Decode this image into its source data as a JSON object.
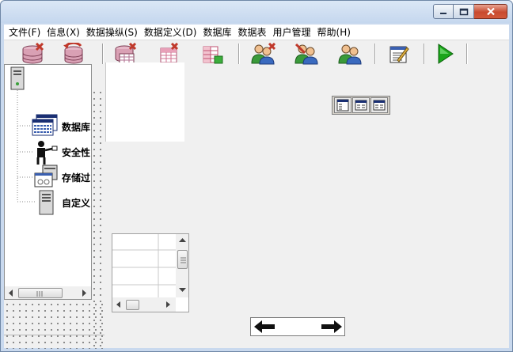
{
  "menu": [
    {
      "label": "文件(F)"
    },
    {
      "label": "信息(X)"
    },
    {
      "label": "数据操纵(S)"
    },
    {
      "label": "数据定义(D)"
    },
    {
      "label": "数据库"
    },
    {
      "label": "数据表"
    },
    {
      "label": "用户管理"
    },
    {
      "label": "帮助(H)"
    }
  ],
  "tree": {
    "items": [
      {
        "label": "数据库",
        "icon": "database-window-icon"
      },
      {
        "label": "安全性",
        "icon": "person-security-icon"
      },
      {
        "label": "存储过",
        "icon": "stored-procedure-icon"
      },
      {
        "label": "自定义",
        "icon": "server-icon"
      }
    ]
  },
  "colors": {
    "accent_red": "#c0392b",
    "toolbar_green": "#1aa51a",
    "title_gradient": "#c5d7ee"
  }
}
